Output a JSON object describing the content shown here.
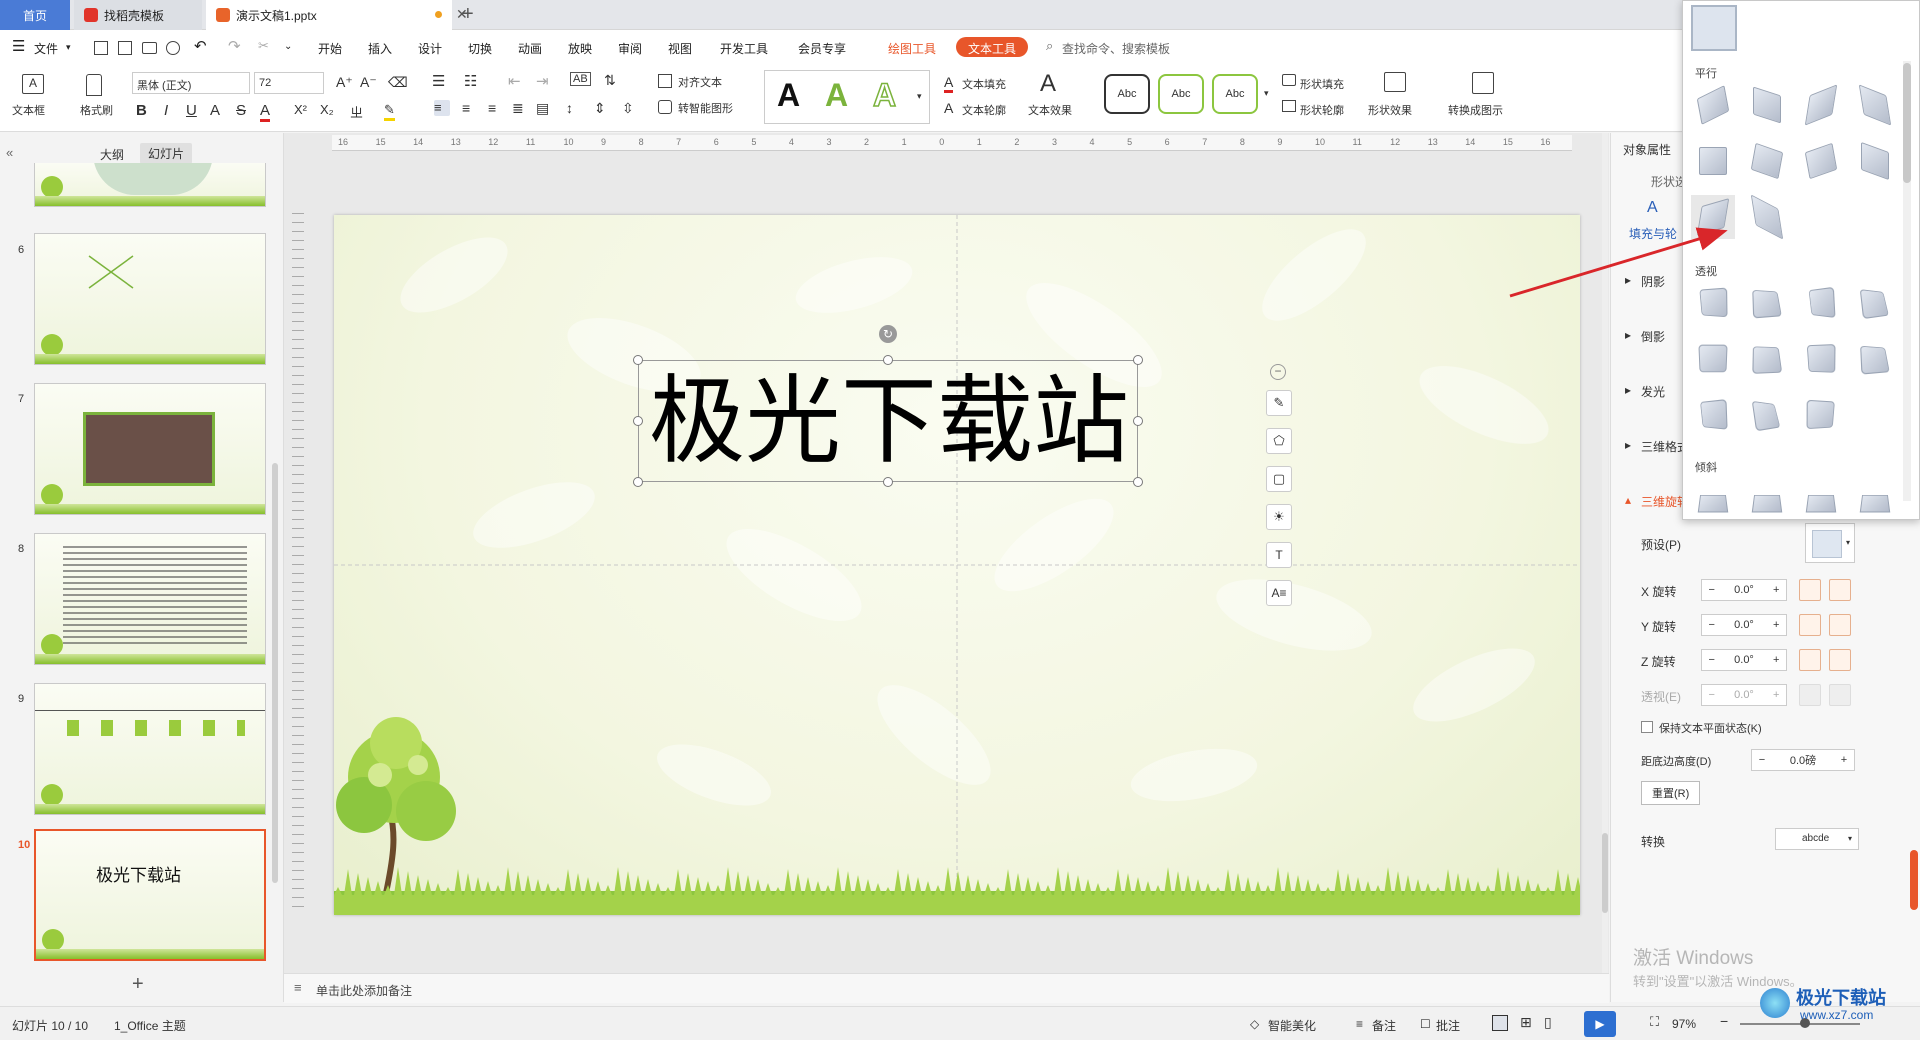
{
  "tabs": {
    "home": "首页",
    "template": "找稻壳模板",
    "document": "演示文稿1.pptx"
  },
  "menu": {
    "file": "文件",
    "items": [
      "开始",
      "插入",
      "设计",
      "切换",
      "动画",
      "放映",
      "审阅",
      "视图",
      "开发工具",
      "会员专享"
    ],
    "drawing_tools": "绘图工具",
    "text_tools": "文本工具",
    "search_placeholder": "查找命令、搜索模板"
  },
  "ribbon": {
    "textbox": "文本框",
    "format_painter": "格式刷",
    "font_name": "黑体 (正文)",
    "font_size": "72",
    "align_text": "对齐文本",
    "smart_shape": "转智能图形",
    "text_fill": "文本填充",
    "text_outline": "文本轮廓",
    "text_effect": "文本效果",
    "style_sample": "Abc",
    "shape_fill": "形状填充",
    "shape_outline": "形状轮廓",
    "shape_effect": "形状效果",
    "convert_to_chart": "转换成图示",
    "wordart_letter": "A"
  },
  "left_panel": {
    "tab_outline": "大纲",
    "tab_slides": "幻灯片",
    "slide_numbers": [
      "6",
      "7",
      "8",
      "9",
      "10"
    ],
    "slide10_title": "极光下载站"
  },
  "slide": {
    "title": "极光下载站",
    "notes_placeholder": "单击此处添加备注"
  },
  "ruler": {
    "labels": [
      "16",
      "15",
      "14",
      "13",
      "12",
      "11",
      "10",
      "9",
      "8",
      "7",
      "6",
      "5",
      "4",
      "3",
      "2",
      "1",
      "0",
      "1",
      "2",
      "3",
      "4",
      "5",
      "6",
      "7",
      "8",
      "9",
      "10",
      "11",
      "12",
      "13",
      "14",
      "15",
      "16"
    ]
  },
  "right_panel": {
    "object_props": "对象属性",
    "shape_tab": "形状选",
    "fill_tab": "填充与轮",
    "sections": [
      "阴影",
      "倒影",
      "发光",
      "三维格式",
      "三维旋转"
    ],
    "preset": "预设(P)",
    "x_rotation": "X 旋转",
    "y_rotation": "Y 旋转",
    "z_rotation": "Z 旋转",
    "perspective": "透视(E)",
    "x_value": "0.0°",
    "y_value": "0.0°",
    "z_value": "0.0°",
    "p_value": "0.0°",
    "keep_flat": "保持文本平面状态(K)",
    "distance": "距底边高度(D)",
    "distance_value": "0.0磅",
    "reset": "重置(R)",
    "transform": "转换",
    "transform_value": "abcde"
  },
  "dropdown": {
    "parallel": "平行",
    "perspective": "透视",
    "oblique": "倾斜"
  },
  "watermark": {
    "line1": "激活 Windows",
    "line2": "转到\"设置\"以激活 Windows。",
    "site": "极光下载站",
    "url": "www.xz7.com"
  },
  "status": {
    "slide_info": "幻灯片 10 / 10",
    "theme": "1_Office 主题",
    "beautify": "智能美化",
    "notes": "备注",
    "comments": "批注",
    "zoom": "97%"
  },
  "colors": {
    "accent": "#e8562a",
    "home_tab": "#4a7bd6",
    "arrow": "#d9262a",
    "leaf": "#8cc63f"
  }
}
